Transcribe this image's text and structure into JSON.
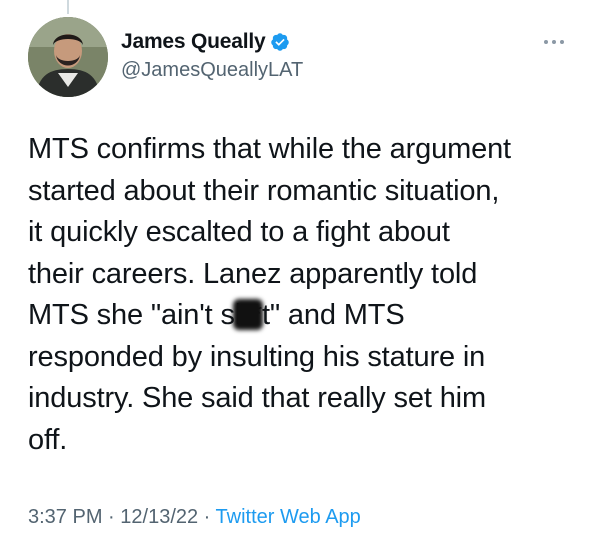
{
  "author": {
    "display_name": "James Queally",
    "handle": "@JamesQueallyLAT",
    "verified": true,
    "verified_color": "#1d9bf0"
  },
  "tweet": {
    "lines": [
      "MTS confirms that while the argument",
      "started about their romantic situation,",
      "it quickly escalted to a fight about",
      "their careers. Lanez apparently told"
    ],
    "line5_before": "MTS she \"ain't ",
    "line5_redacted_word": "sh*t",
    "line5_after": "\" and MTS",
    "lines_end": [
      "responded by insulting his stature in",
      "industry. She said that really set him",
      "off."
    ]
  },
  "meta": {
    "time": "3:37 PM",
    "separator": " · ",
    "date": "12/13/22",
    "source": "Twitter Web App"
  },
  "icons": {
    "verified": "verified-badge-icon",
    "more": "more-options-icon"
  }
}
